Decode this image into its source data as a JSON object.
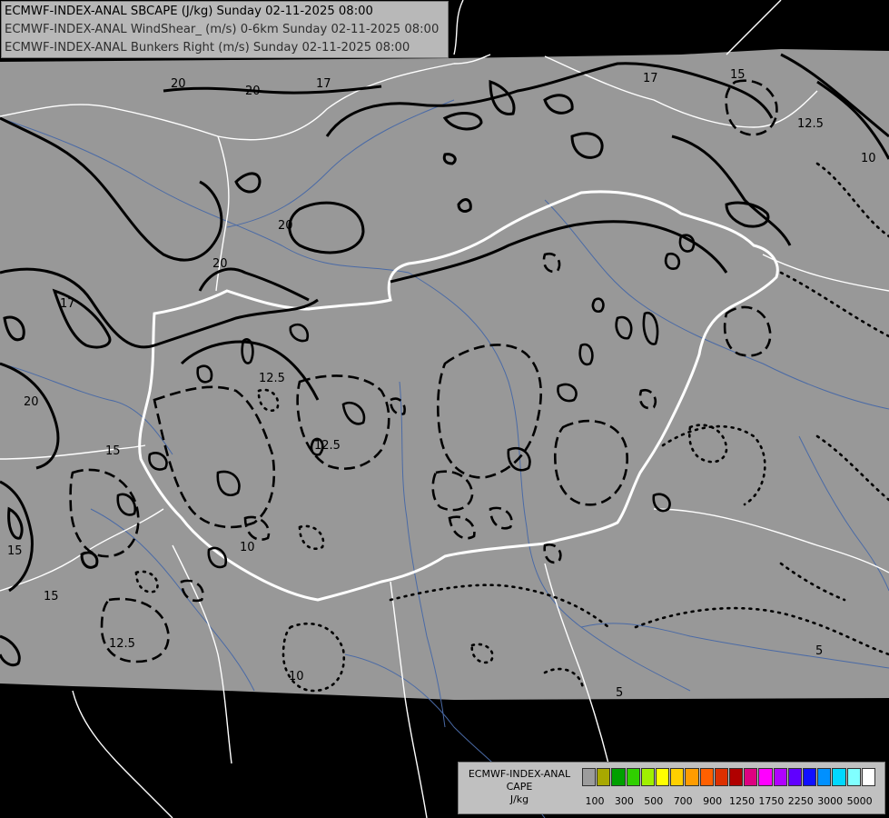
{
  "header": {
    "lines": [
      "ECMWF-INDEX-ANAL SBCAPE (J/kg) Sunday 02-11-2025 08:00",
      "ECMWF-INDEX-ANAL WindShear_ (m/s) 0-6km Sunday 02-11-2025 08:00",
      "ECMWF-INDEX-ANAL Bunkers Right (m/s) Sunday 02-11-2025 08:00"
    ]
  },
  "legend": {
    "label_lines": [
      "ECMWF-INDEX-ANAL",
      "CAPE",
      "J/kg"
    ],
    "swatch_colors": [
      "#9c9c9c",
      "#a8a800",
      "#00a000",
      "#30d000",
      "#a0f000",
      "#ffff00",
      "#ffd000",
      "#ff9c00",
      "#ff6000",
      "#dd3000",
      "#b00000",
      "#dd0080",
      "#ff00ff",
      "#b000ff",
      "#6000ff",
      "#1010ff",
      "#0090ff",
      "#00d8ff",
      "#80ffff",
      "#ffffff"
    ],
    "tick_labels": [
      "100",
      "300",
      "500",
      "700",
      "900",
      "1250",
      "1750",
      "2250",
      "3000",
      "5000"
    ]
  },
  "map": {
    "colors": {
      "night": "#000000",
      "field": "#989898",
      "border": "#ffffff",
      "hungary_border": "#ffffff",
      "river": "#4a6aa6",
      "contour": "#000000"
    },
    "contour_labels": [
      {
        "text": "20"
      },
      {
        "text": "20"
      },
      {
        "text": "17"
      },
      {
        "text": "17"
      },
      {
        "text": "15"
      },
      {
        "text": "12.5"
      },
      {
        "text": "10"
      },
      {
        "text": "20"
      },
      {
        "text": "20"
      },
      {
        "text": "17"
      },
      {
        "text": "20"
      },
      {
        "text": "15"
      },
      {
        "text": "12.5"
      },
      {
        "text": "15"
      },
      {
        "text": "12.5"
      },
      {
        "text": "10"
      },
      {
        "text": "12.5"
      },
      {
        "text": "10"
      },
      {
        "text": "15"
      },
      {
        "text": "5"
      },
      {
        "text": "5"
      }
    ]
  }
}
